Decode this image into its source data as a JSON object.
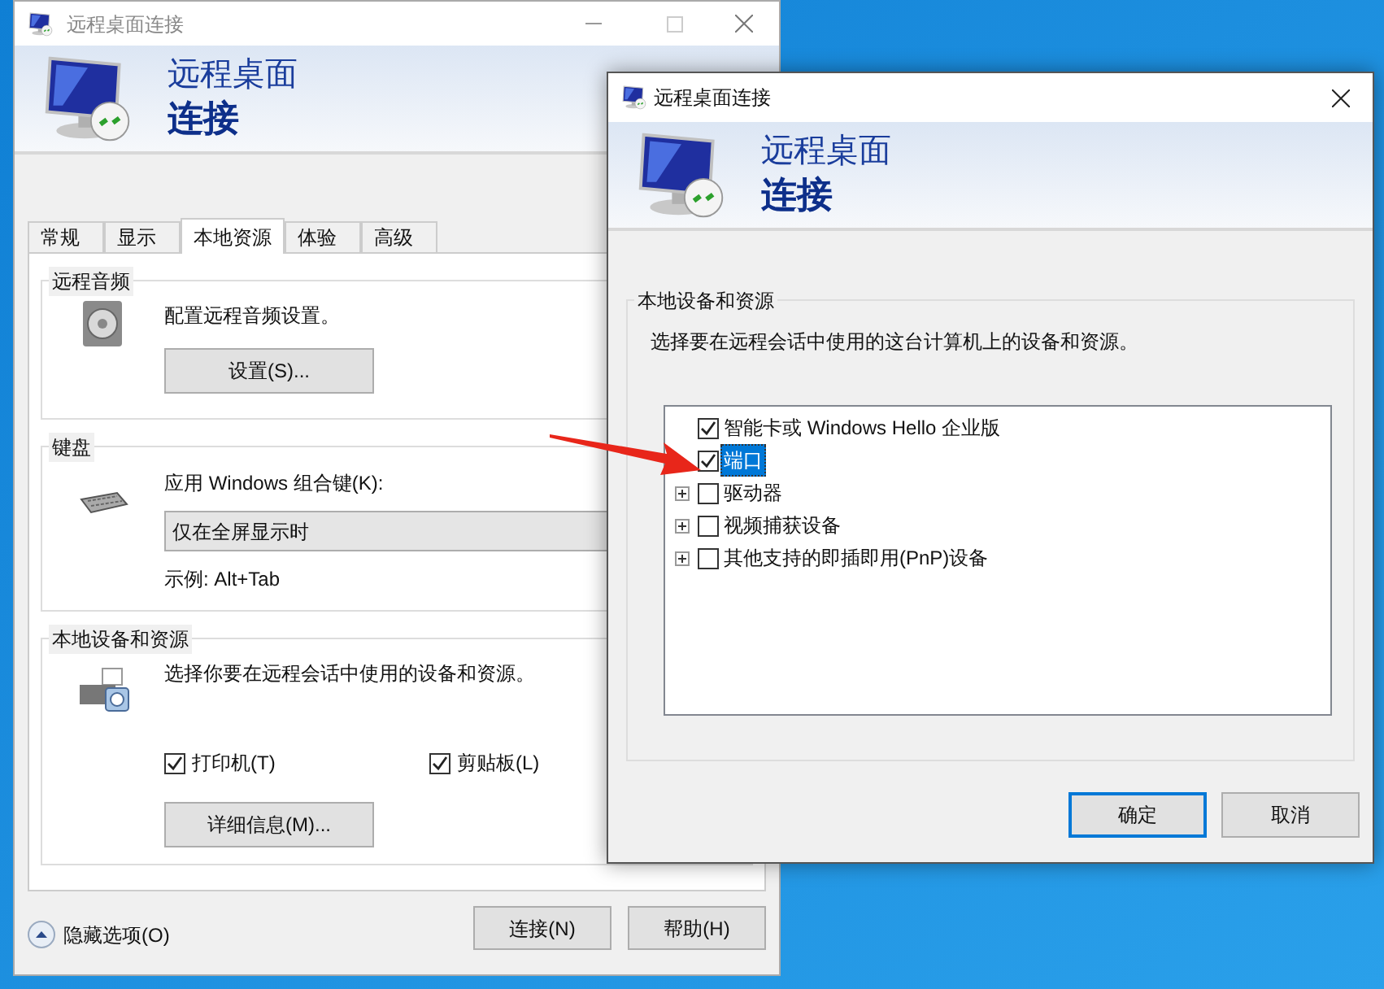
{
  "main_window": {
    "title": "远程桌面连接",
    "banner": {
      "line1": "远程桌面",
      "line2": "连接"
    },
    "tabs": [
      {
        "label": "常规",
        "selected": false
      },
      {
        "label": "显示",
        "selected": false
      },
      {
        "label": "本地资源",
        "selected": true
      },
      {
        "label": "体验",
        "selected": false
      },
      {
        "label": "高级",
        "selected": false
      }
    ],
    "audio": {
      "legend": "远程音频",
      "text": "配置远程音频设置。",
      "button": "设置(S)..."
    },
    "keyboard": {
      "legend": "键盘",
      "label": "应用 Windows 组合键(K):",
      "dropdown_value": "仅在全屏显示时",
      "example": "示例: Alt+Tab"
    },
    "devices": {
      "legend": "本地设备和资源",
      "text": "选择你要在远程会话中使用的设备和资源。",
      "checkboxes": [
        {
          "label": "打印机(T)",
          "checked": true
        },
        {
          "label": "剪贴板(L)",
          "checked": true
        }
      ],
      "button": "详细信息(M)..."
    },
    "hide_options": "隐藏选项(O)",
    "buttons": [
      "连接(N)",
      "帮助(H)"
    ]
  },
  "dialog": {
    "title": "远程桌面连接",
    "banner": {
      "line1": "远程桌面",
      "line2": "连接"
    },
    "legend": "本地设备和资源",
    "text": "选择要在远程会话中使用的这台计算机上的设备和资源。",
    "tree": [
      {
        "label": "智能卡或 Windows Hello 企业版",
        "checked": true,
        "selected": false
      },
      {
        "label": "端口",
        "checked": true,
        "selected": true
      },
      {
        "label": "驱动器",
        "checked": false,
        "selected": false,
        "expanded": false
      },
      {
        "label": "视频捕获设备",
        "checked": false,
        "selected": false,
        "expanded": false
      },
      {
        "label": "其他支持的即插即用(PnP)设备",
        "checked": false,
        "selected": false,
        "expanded": false
      }
    ],
    "ok": "确定",
    "cancel": "取消"
  }
}
